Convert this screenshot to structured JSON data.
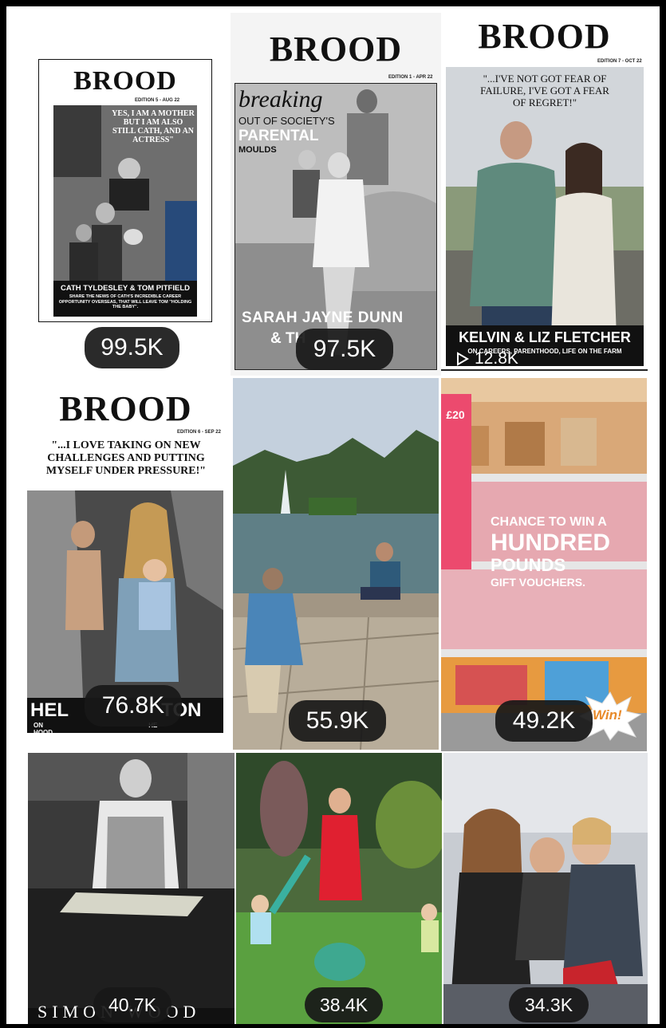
{
  "tiles": [
    {
      "count": "99.5K",
      "brand": "BROOD",
      "edition": "EDITION 5 - AUG 22",
      "quote": "YES, I AM A MOTHER BUT I AM ALSO STILL CATH, AND AN ACTRESS\"",
      "names": "CATH TYLDESLEY & TOM PITFIELD",
      "sub": "SHARE THE NEWS OF CATH'S INCREDIBLE CAREER OPPORTUNITY OVERSEAS, THAT WILL LEAVE TOM \"HOLDING THE BABY\"."
    },
    {
      "count": "97.5K",
      "brand": "BROOD",
      "edition": "EDITION 1 - APR 22",
      "line1": "breaking",
      "line2": "OUT OF SOCIETY'S",
      "line3": "PARENTAL",
      "line4": "MOULDS",
      "names": "SARAH JAYNE DUNN",
      "names2": "& TH"
    },
    {
      "count": "12.8K",
      "brand": "BROOD",
      "edition": "EDITION 7 - OCT 22",
      "quote": "\"...I'VE NOT GOT FEAR OF FAILURE, I'VE GOT A FEAR OF REGRET!\"",
      "names": "KELVIN & LIZ FLETCHER",
      "sub": "ON CAREERS, PARENTHOOD, LIFE ON THE FARM"
    },
    {
      "count": "76.8K",
      "brand": "BROOD",
      "edition": "EDITION 6 - SEP 22",
      "quote": "\"...I LOVE TAKING ON NEW CHALLENGES AND PUTTING MYSELF UNDER PRESSURE!\"",
      "names": "HEL TON",
      "sub1": "ON HE HOOD,",
      "sub2": "AND C RATIVE"
    },
    {
      "count": "55.9K"
    },
    {
      "count": "49.2K",
      "promo1": "CHANCE TO WIN A",
      "promo2": "HUNDRED",
      "promo3": "POUNDS",
      "promo4": "GIFT VOUCHERS.",
      "sign": "£20",
      "win": "Win!"
    },
    {
      "count": "40.7K",
      "caption": "SIMON WOOD"
    },
    {
      "count": "38.4K"
    },
    {
      "count": "34.3K"
    }
  ],
  "colors": {
    "accent": "#1a1a1a",
    "badge": "#181818",
    "cyan": "#3fd0d0"
  },
  "icons": {
    "play": "play-icon"
  }
}
